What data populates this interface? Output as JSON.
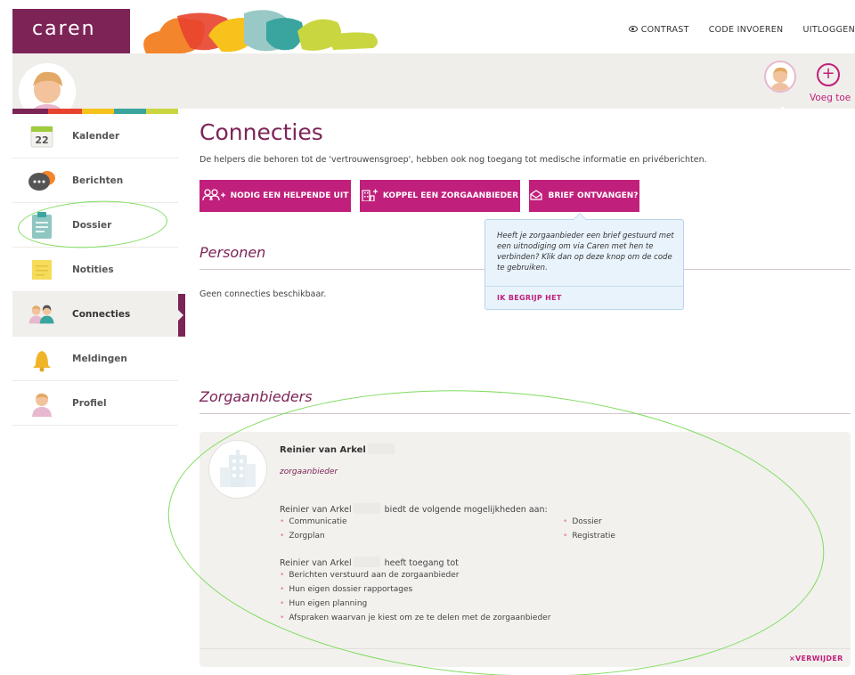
{
  "app": {
    "logo": "caren"
  },
  "top_links": {
    "contrast": "CONTRAST",
    "code": "CODE INVOEREN",
    "logout": "UITLOGGEN"
  },
  "header": {
    "add_label": "Voeg toe",
    "add_symbol": "+"
  },
  "sidebar": {
    "items": [
      {
        "label": "Kalender",
        "icon": "calendar-icon",
        "day": "22"
      },
      {
        "label": "Berichten",
        "icon": "chat-icon"
      },
      {
        "label": "Dossier",
        "icon": "clipboard-icon"
      },
      {
        "label": "Notities",
        "icon": "notes-icon"
      },
      {
        "label": "Connecties",
        "icon": "people-icon",
        "active": true
      },
      {
        "label": "Meldingen",
        "icon": "bell-icon"
      },
      {
        "label": "Profiel",
        "icon": "profile-icon"
      }
    ]
  },
  "main": {
    "title": "Connecties",
    "description": "De helpers die behoren tot de 'vertrouwensgroep', hebben ook nog toegang tot medische informatie en privéberichten.",
    "buttons": {
      "invite": "NODIG EEN HELPENDE UIT",
      "provider": "KOPPEL EEN ZORGAANBIEDER",
      "letter": "BRIEF ONTVANGEN?"
    },
    "persons": {
      "title": "Personen",
      "empty": "Geen connecties beschikbaar."
    },
    "tooltip": {
      "text": "Heeft je zorgaanbieder een brief gestuurd met een uitnodiging om via Caren met hen te verbinden? Klik dan op deze knop om de code te gebruiken.",
      "action": "IK BEGRIJP HET"
    },
    "providers": {
      "title": "Zorgaanbieders",
      "card": {
        "name": "Reinier van Arkel",
        "role": "zorgaanbieder",
        "offers_name": "Reinier van Arkel",
        "offers_text": "biedt de volgende mogelijkheden aan:",
        "offers_left": [
          "Communicatie",
          "Zorgplan"
        ],
        "offers_right": [
          "Dossier",
          "Registratie"
        ],
        "access_name": "Reinier van Arkel",
        "access_text": "heeft toegang tot",
        "access": [
          "Berichten verstuurd aan de zorgaanbieder",
          "Hun eigen dossier rapportages",
          "Hun eigen planning",
          "Afspraken waarvan je kiest om ze te delen met de zorgaanbieder"
        ],
        "remove": "VERWIJDER",
        "remove_symbol": "×"
      }
    }
  },
  "colors": {
    "brand": "#7d2457",
    "accent": "#c0207b",
    "annotation": "#7fdc5e"
  }
}
